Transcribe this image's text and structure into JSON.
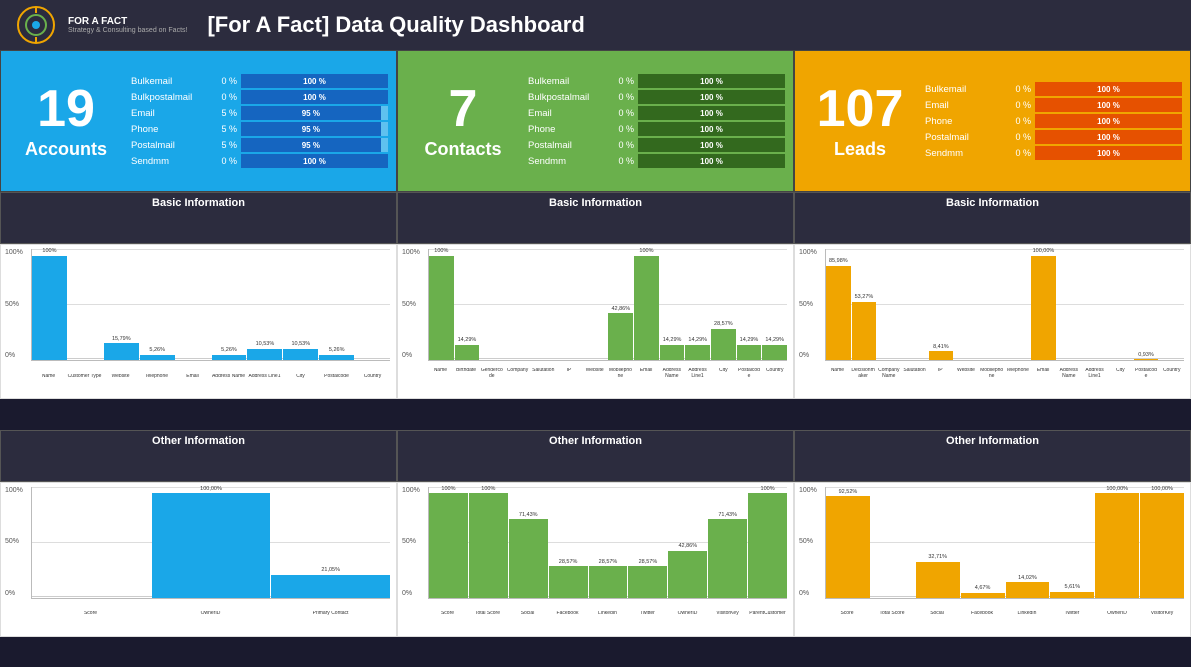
{
  "header": {
    "title": "[For A Fact] Data Quality Dashboard",
    "logo_text": "FOR A FACT",
    "logo_sub": "Strategy & Consulting based on Facts!"
  },
  "panels": [
    {
      "id": "accounts",
      "color": "blue",
      "number": "19",
      "label": "Accounts",
      "metrics": [
        {
          "name": "Bulkemail",
          "left_pct": "0 %",
          "bar_pct": "100 %"
        },
        {
          "name": "Bulkpostalmail",
          "left_pct": "0 %",
          "bar_pct": "100 %"
        },
        {
          "name": "Email",
          "left_pct": "5 %",
          "bar_pct": "95 %"
        },
        {
          "name": "Phone",
          "left_pct": "5 %",
          "bar_pct": "95 %"
        },
        {
          "name": "Postalmail",
          "left_pct": "5 %",
          "bar_pct": "95 %"
        },
        {
          "name": "Sendmm",
          "left_pct": "0 %",
          "bar_pct": "100 %"
        }
      ]
    },
    {
      "id": "contacts",
      "color": "green",
      "number": "7",
      "label": "Contacts",
      "metrics": [
        {
          "name": "Bulkemail",
          "left_pct": "0 %",
          "bar_pct": "100 %"
        },
        {
          "name": "Bulkpostalmail",
          "left_pct": "0 %",
          "bar_pct": "100 %"
        },
        {
          "name": "Email",
          "left_pct": "0 %",
          "bar_pct": "100 %"
        },
        {
          "name": "Phone",
          "left_pct": "0 %",
          "bar_pct": "100 %"
        },
        {
          "name": "Postalmail",
          "left_pct": "0 %",
          "bar_pct": "100 %"
        },
        {
          "name": "Sendmm",
          "left_pct": "0 %",
          "bar_pct": "100 %"
        }
      ]
    },
    {
      "id": "leads",
      "color": "orange",
      "number": "107",
      "label": "Leads",
      "metrics": [
        {
          "name": "Bulkemail",
          "left_pct": "0 %",
          "bar_pct": "100 %"
        },
        {
          "name": "Email",
          "left_pct": "0 %",
          "bar_pct": "100 %"
        },
        {
          "name": "Phone",
          "left_pct": "0 %",
          "bar_pct": "100 %"
        },
        {
          "name": "Postalmail",
          "left_pct": "0 %",
          "bar_pct": "100 %"
        },
        {
          "name": "Sendmm",
          "left_pct": "0 %",
          "bar_pct": "100 %"
        }
      ]
    }
  ],
  "section_headers": {
    "basic_info": "Basic Information",
    "other_info": "Other Information"
  },
  "charts": {
    "accounts_basic": {
      "color": "blue",
      "bars": [
        {
          "label": "Name",
          "value": 100,
          "display": "100%"
        },
        {
          "label": "Customer Type",
          "value": 0,
          "display": ""
        },
        {
          "label": "Website",
          "value": 15.79,
          "display": "15,79%"
        },
        {
          "label": "Telephone",
          "value": 5.26,
          "display": "5,26%"
        },
        {
          "label": "Email",
          "value": 0,
          "display": ""
        },
        {
          "label": "Address Name",
          "value": 5.26,
          "display": "5,26%"
        },
        {
          "label": "Address Line1",
          "value": 10.53,
          "display": "10,53%"
        },
        {
          "label": "City",
          "value": 10.53,
          "display": "10,53%"
        },
        {
          "label": "Postalcode",
          "value": 5.26,
          "display": "5,26%"
        },
        {
          "label": "Country",
          "value": 0,
          "display": ""
        }
      ]
    },
    "contacts_basic": {
      "color": "green",
      "bars": [
        {
          "label": "Name",
          "value": 100,
          "display": "100%"
        },
        {
          "label": "Birthdate",
          "value": 14.29,
          "display": "14,29%"
        },
        {
          "label": "Gendercode",
          "value": 0,
          "display": ""
        },
        {
          "label": "Company",
          "value": 0,
          "display": ""
        },
        {
          "label": "Salutation",
          "value": 0,
          "display": ""
        },
        {
          "label": "IP",
          "value": 0,
          "display": ""
        },
        {
          "label": "Website",
          "value": 0,
          "display": ""
        },
        {
          "label": "Mobilephone",
          "value": 42.86,
          "display": "42,86%"
        },
        {
          "label": "Email",
          "value": 100,
          "display": "100%"
        },
        {
          "label": "Address Name",
          "value": 14.29,
          "display": "14,29%"
        },
        {
          "label": "Address Line1",
          "value": 14.29,
          "display": "14,29%"
        },
        {
          "label": "City",
          "value": 28.57,
          "display": "28,57%"
        },
        {
          "label": "Postalcode",
          "value": 14.29,
          "display": "14,29%"
        },
        {
          "label": "Country",
          "value": 14.29,
          "display": "14,29%"
        }
      ]
    },
    "leads_basic": {
      "color": "orange",
      "bars": [
        {
          "label": "Name",
          "value": 85.98,
          "display": "85,98%"
        },
        {
          "label": "Decisionmaker",
          "value": 53.27,
          "display": "53,27%"
        },
        {
          "label": "Company Name",
          "value": 0,
          "display": ""
        },
        {
          "label": "Salutation",
          "value": 0,
          "display": ""
        },
        {
          "label": "IP",
          "value": 8.41,
          "display": "8,41%"
        },
        {
          "label": "Website",
          "value": 0,
          "display": ""
        },
        {
          "label": "Mobilephone",
          "value": 0,
          "display": ""
        },
        {
          "label": "Telephone",
          "value": 0,
          "display": ""
        },
        {
          "label": "Email",
          "value": 100,
          "display": "100,00%"
        },
        {
          "label": "Address Name",
          "value": 0,
          "display": ""
        },
        {
          "label": "Address Line1",
          "value": 0,
          "display": ""
        },
        {
          "label": "City",
          "value": 0,
          "display": ""
        },
        {
          "label": "Postalcode",
          "value": 0.93,
          "display": "0,93%"
        },
        {
          "label": "Country",
          "value": 0,
          "display": ""
        }
      ]
    },
    "accounts_other": {
      "color": "blue",
      "bars": [
        {
          "label": "Score",
          "value": 0,
          "display": ""
        },
        {
          "label": "OwnerID",
          "value": 100,
          "display": "100,00%"
        },
        {
          "label": "Primary Contact",
          "value": 21.05,
          "display": "21,05%"
        }
      ]
    },
    "contacts_other": {
      "color": "green",
      "bars": [
        {
          "label": "Score",
          "value": 100,
          "display": "100%"
        },
        {
          "label": "Total Score",
          "value": 100,
          "display": "100%"
        },
        {
          "label": "Social",
          "value": 71.43,
          "display": "71,43%"
        },
        {
          "label": "Facebook",
          "value": 28.57,
          "display": "28,57%"
        },
        {
          "label": "LinkedIn",
          "value": 28.57,
          "display": "28,57%"
        },
        {
          "label": "Twitter",
          "value": 28.57,
          "display": "28,57%"
        },
        {
          "label": "OwnerID",
          "value": 42.86,
          "display": "42,86%"
        },
        {
          "label": "VisitorKey",
          "value": 71.43,
          "display": "71,43%"
        },
        {
          "label": "ParentCustomer",
          "value": 100,
          "display": "100%"
        }
      ]
    },
    "leads_other": {
      "color": "orange",
      "bars": [
        {
          "label": "Score",
          "value": 92.52,
          "display": "92,52%"
        },
        {
          "label": "Total Score",
          "value": 0,
          "display": ""
        },
        {
          "label": "Social",
          "value": 32.71,
          "display": "32,71%"
        },
        {
          "label": "Facebook",
          "value": 4.67,
          "display": "4,67%"
        },
        {
          "label": "LinkedIn",
          "value": 14.02,
          "display": "14,02%"
        },
        {
          "label": "Twitter",
          "value": 5.61,
          "display": "5,61%"
        },
        {
          "label": "OwnerID",
          "value": 100,
          "display": "100,00%"
        },
        {
          "label": "VisitorKey",
          "value": 100,
          "display": "100,00%"
        }
      ]
    }
  }
}
